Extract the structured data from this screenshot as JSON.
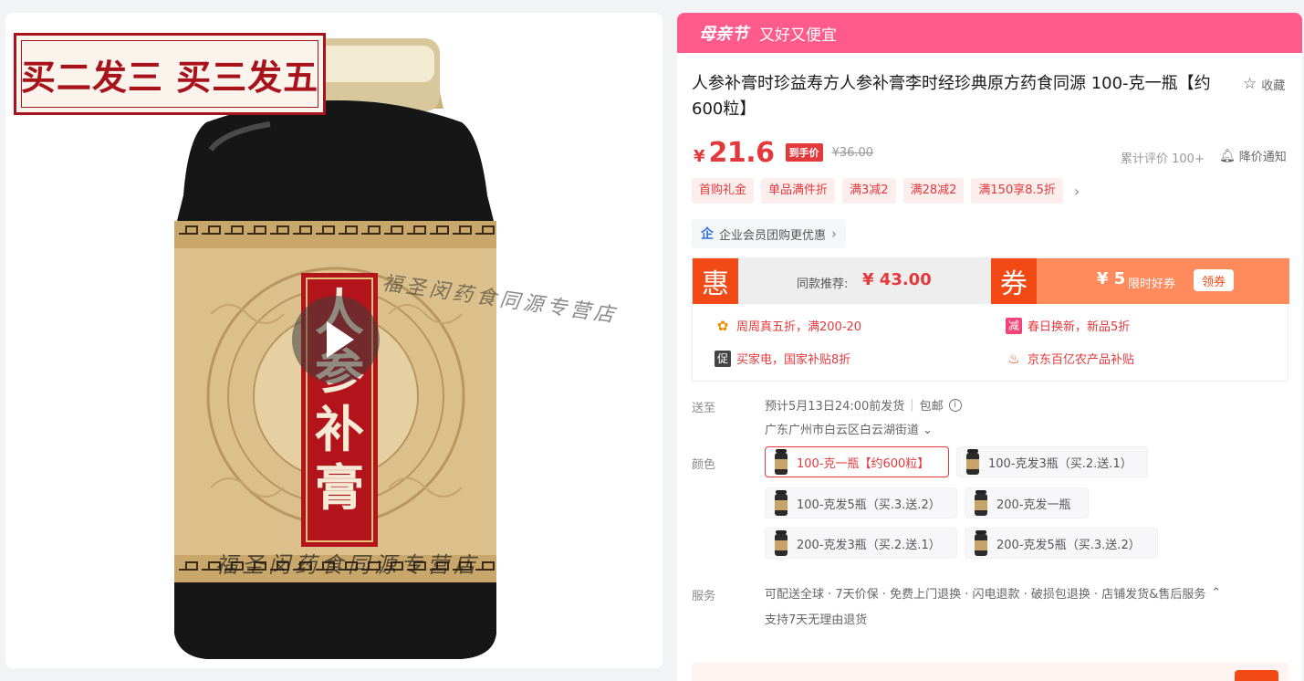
{
  "gallery": {
    "promo_stamp": "买二发三 买三发五",
    "watermark": "福圣闵药食同源专营店",
    "label_text": [
      "人",
      "参",
      "补",
      "膏"
    ]
  },
  "festival": {
    "logo": "母亲节",
    "slogan": "又好又便宜"
  },
  "product": {
    "title": "人参补膏时珍益寿方人参补膏李时经珍典原方药食同源 100-克一瓶【约600粒】",
    "favorite_label": "收藏",
    "price_symbol": "¥",
    "price": "21.6",
    "price_tag": "到手价",
    "original_price": "¥36.00",
    "review_count": "累计评价 100+",
    "price_alert": "降价通知"
  },
  "promo_tags": [
    "首购礼金",
    "单品满件折",
    "满3减2",
    "满28减2",
    "满150享8.5折"
  ],
  "enterprise_label": "企业会员团购更优惠",
  "deal": {
    "hui": "惠",
    "same_rec_label": "同款推荐:",
    "same_rec_price": "¥ 43.00",
    "quan": "券",
    "coupon_value": "¥ 5",
    "coupon_desc": "限时好券",
    "coupon_button": "领券",
    "items": [
      {
        "icon": "减",
        "text": "周周真五折，满200-20"
      },
      {
        "icon": "减",
        "text": "春日换新，新品5折"
      },
      {
        "icon": "促",
        "text": "买家电，国家补贴8折"
      },
      {
        "icon": "火",
        "text": "京东百亿农产品补贴"
      }
    ]
  },
  "delivery": {
    "label": "送至",
    "eta": "预计5月13日24:00前发货",
    "shipping": "包邮",
    "address": "广东广州市白云区白云湖街道"
  },
  "variants": {
    "label": "颜色",
    "options": [
      "100-克一瓶【约600粒】",
      "100-克发3瓶（买.2.送.1）",
      "100-克发5瓶（买.3.送.2）",
      "200-克发一瓶",
      "200-克发3瓶（买.2.送.1）",
      "200-克发5瓶（买.3.送.2）"
    ],
    "selected_index": 0
  },
  "service": {
    "label": "服务",
    "items": "可配送全球 · 7天价保 · 免费上门退换 · 闪电退款 · 破损包退换 · 店铺发货&售后服务",
    "sub": "支持7天无理由退货"
  },
  "colors": {
    "accent_red": "#e4393c",
    "festival_pink": "#ff5a8c",
    "deal_orange": "#f34a15",
    "coupon_orange": "#ff8a5c"
  }
}
